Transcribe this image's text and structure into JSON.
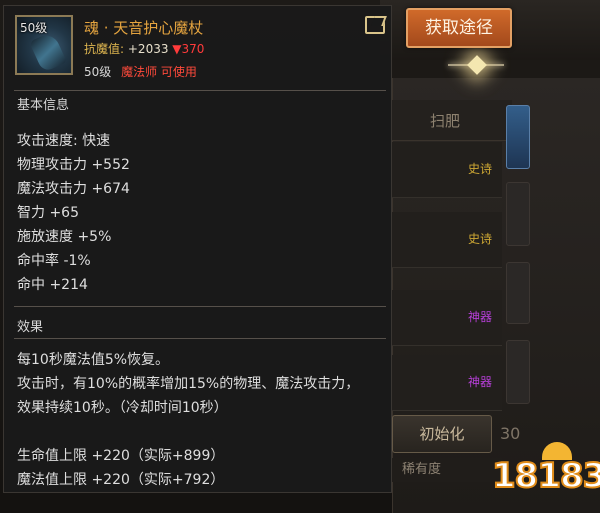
{
  "action_button": {
    "label": "获取途径"
  },
  "background": {
    "header_label": "扫肥",
    "row_tags": [
      "史诗",
      "史诗",
      "神器",
      "神器"
    ],
    "init_button": "初始化",
    "rarity_label": "稀有度",
    "side_number": "30"
  },
  "tooltip": {
    "icon_level": "50级",
    "name": "魂 · 天音护心魔杖",
    "resist_label": "抗魔值:",
    "resist_value": "+2033",
    "resist_down": "▼370",
    "required_level": "50级",
    "class_requirement": "魔法师 可使用",
    "basic_title": "基本信息",
    "stats": [
      "攻击速度: 快速",
      "物理攻击力 +552",
      "魔法攻击力 +674",
      "智力 +65",
      "施放速度 +5%",
      "命中率 -1%",
      "命中 +214"
    ],
    "effect_title": "效果",
    "effect_lines": [
      "每10秒魔法值5%恢复。",
      "攻击时，有10%的概率增加15%的物理、魔法攻击力，",
      "效果持续10秒。（冷却时间10秒）",
      "生命值上限 +220（实际+899）",
      "魔法值上限 +220（实际+792）"
    ]
  },
  "watermark": {
    "text": "18183"
  },
  "colors": {
    "item_name": "#e5a43f",
    "negative": "#ff3b3b",
    "epic_tag": "#cfa834",
    "artifact_tag": "#b63fd7",
    "button": "#c45f25"
  }
}
